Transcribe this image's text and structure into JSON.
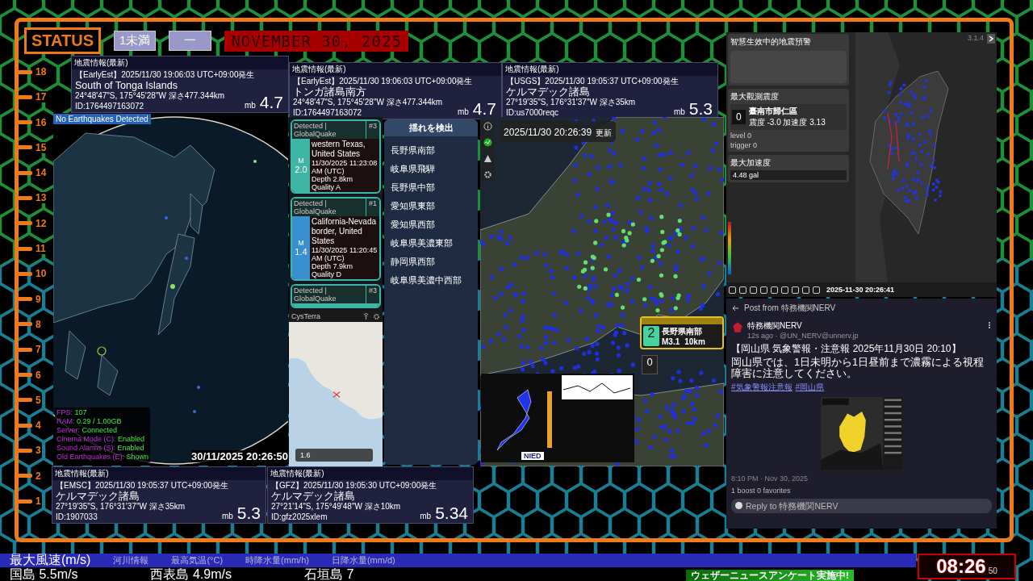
{
  "status": {
    "label": "STATUS",
    "intensity": "1未満",
    "tsunami": "一",
    "date": "NOVEMBER 30, 2025"
  },
  "scale": [
    "18",
    "17",
    "16",
    "15",
    "14",
    "13",
    "12",
    "11",
    "10",
    "9",
    "8",
    "7",
    "6",
    "5",
    "4",
    "3",
    "2",
    "1"
  ],
  "quake_cards": [
    {
      "title": "地震情報(最新)",
      "source_line": "【EarlyEst】2025/11/30  19:06:03  UTC+09:00発生",
      "region": "South of Tonga Islands",
      "coords": "24°48'47\"S,  175°45'28\"W   深さ477.344km",
      "id": "ID:1764497163072",
      "mag_type": "mb",
      "magnitude": "4.7"
    },
    {
      "title": "地震情報(最新)",
      "source_line": "【EarlyEst】2025/11/30  19:06:03  UTC+09:00発生",
      "region": "トンガ諸島南方",
      "coords": "24°48'47\"S,  175°45'28\"W   深さ477.344km",
      "id": "ID:1764497163072",
      "mag_type": "mb",
      "magnitude": "4.7"
    },
    {
      "title": "地震情報(最新)",
      "source_line": "【USGS】2025/11/30  19:05:37  UTC+09:00発生",
      "region": "ケルマデック諸島",
      "coords": "27°19'35\"S,  176°31'37\"W   深さ35km",
      "id": "ID:us7000reqc",
      "mag_type": "mb",
      "magnitude": "5.3"
    },
    {
      "title": "地震情報(最新)",
      "source_line": "【EMSC】2025/11/30  19:05:37  UTC+09:00発生",
      "region": "ケルマデック諸島",
      "coords": "27°19'35\"S,  176°31'37\"W   深さ35km",
      "id": "ID:1907033",
      "mag_type": "mb",
      "magnitude": "5.3"
    },
    {
      "title": "地震情報(最新)",
      "source_line": "【GFZ】2025/11/30  19:05:30  UTC+09:00発生",
      "region": "ケルマデック諸島",
      "coords": "27°21'14\"S,  175°49'48\"W   深さ10km",
      "id": "ID:gfz2025xlem",
      "mag_type": "mb",
      "magnitude": "5.34"
    }
  ],
  "globe": {
    "badge": "No Earthquakes Detected",
    "stats": [
      {
        "label": "FPS:",
        "value": "107"
      },
      {
        "label": "RAM:",
        "value": "0.29 / 1.00GB"
      },
      {
        "label": "Server:",
        "value": "Connected"
      },
      {
        "label": "Cinema Mode (C):",
        "value": "Enabled"
      },
      {
        "label": "Sound Alarms (S):",
        "value": "Enabled"
      },
      {
        "label": "Old Earthquakes (E):",
        "value": "Shown"
      }
    ],
    "timestamp": "30/11/2025 20:26:50"
  },
  "globalquake": {
    "cards": [
      {
        "header": "Detected | GlobalQuake",
        "number": "#3",
        "color": "#3fb5a5",
        "mag_label": "M",
        "magnitude": "2.0",
        "region": "western Texas, United States",
        "time": "11/30/2025 11:23:08 AM (UTC)",
        "depth": "Depth 2.8km",
        "quality": "Quality A"
      },
      {
        "header": "Detected | GlobalQuake",
        "number": "#1",
        "color": "#3a8fd0",
        "mag_label": "M",
        "magnitude": "1.4",
        "region": "California-Nevada border, United States",
        "time": "11/30/2025 11:20:45 AM (UTC)",
        "depth": "Depth 7.9km",
        "quality": "Quality D"
      },
      {
        "header": "Detected | GlobalQuake",
        "number": "#3",
        "color": "#3fb5a5"
      }
    ]
  },
  "cysterra": {
    "title": "CysTerra",
    "magnitude": "1.6"
  },
  "shaking": {
    "title": "揺れを検出",
    "regions": [
      "長野県南部",
      "岐阜県飛騨",
      "長野県中部",
      "愛知県東部",
      "愛知県西部",
      "岐阜県美濃東部",
      "静岡県西部",
      "岐阜県美濃中西部"
    ]
  },
  "japan_map": {
    "updated": "2025/11/30  20:26:39",
    "updated_label": "更新",
    "alert": {
      "intensity": "2",
      "region": "長野県南部",
      "magnitude": "M3.1",
      "depth": "10km"
    },
    "max_intensity": "0",
    "inset_logo": "NIED"
  },
  "taiwan": {
    "title": "智慧生效中的地震預警",
    "version": "3.1.4",
    "max_label": "最大觀測震度",
    "station": {
      "intensity": "0",
      "name": "臺南市歸仁區",
      "detail": "震度 -3.0   加速度 3.13",
      "level": "level   0",
      "trigger": "trigger   0"
    },
    "pga_label": "最大加速度",
    "pga": "4.48 gal",
    "timestamp": "2025-11-30 20:26:41"
  },
  "post": {
    "header": "Post from 特務機関NERV",
    "author": "特務機関NERV",
    "meta": "12s ago · @UN_NERV@unnerv.jp",
    "lines": [
      "【岡山県 気象警報・注意報 2025年11月30日 20:10】",
      "岡山県では、1日未明から1日昼前まで濃霧による視程障害に注意してください。"
    ],
    "tags": [
      "#気象警報注意報",
      "#岡山県"
    ],
    "date": "8:10 PM · Nov 30, 2025",
    "stats": "1 boost  0 favorites",
    "reply_placeholder": "Reply to 特務機関NERV"
  },
  "ticker": {
    "headings": [
      {
        "text": "最大風速(m/s)",
        "selected": true
      },
      {
        "text": "河川情報",
        "selected": false
      },
      {
        "text": "最高気温(°C)",
        "selected": false
      },
      {
        "text": "時降水量(mm/h)",
        "selected": false
      },
      {
        "text": "日降水量(mm/d)",
        "selected": false
      }
    ],
    "values": [
      "国島 5.5m/s",
      "西表島 4.9m/s",
      "石垣島 7"
    ],
    "banner": "ウェザーニュースアンケート実施中!"
  },
  "clock": {
    "time": "08:26",
    "seconds": "50"
  }
}
